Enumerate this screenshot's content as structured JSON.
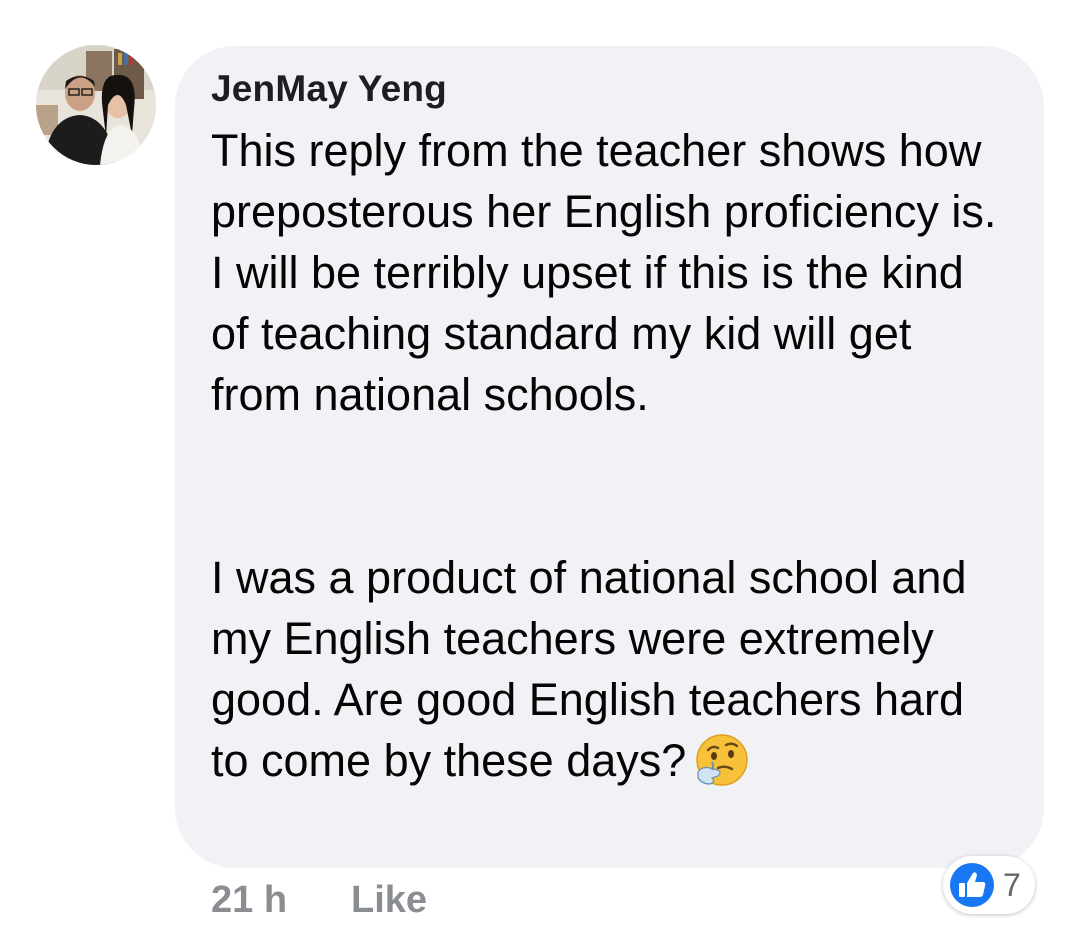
{
  "comment": {
    "author": "JenMay Yeng",
    "paragraphs": [
      "This reply from the teacher shows how preposterous her English proficiency is. I will be terribly upset if this is the kind of teaching standard my kid will get from national schools.",
      "I was a product of national school and my English teachers were extremely good. Are good English teachers hard to come by these days?"
    ],
    "emoji": "thinking-face-icon"
  },
  "footer": {
    "time": "21 h",
    "like_label": "Like"
  },
  "reactions": {
    "icon": "like-reaction-icon",
    "count": "7",
    "color": "#1877f2"
  },
  "colors": {
    "bubble": "#f0f2f5",
    "meta_text": "#8a8d91"
  }
}
